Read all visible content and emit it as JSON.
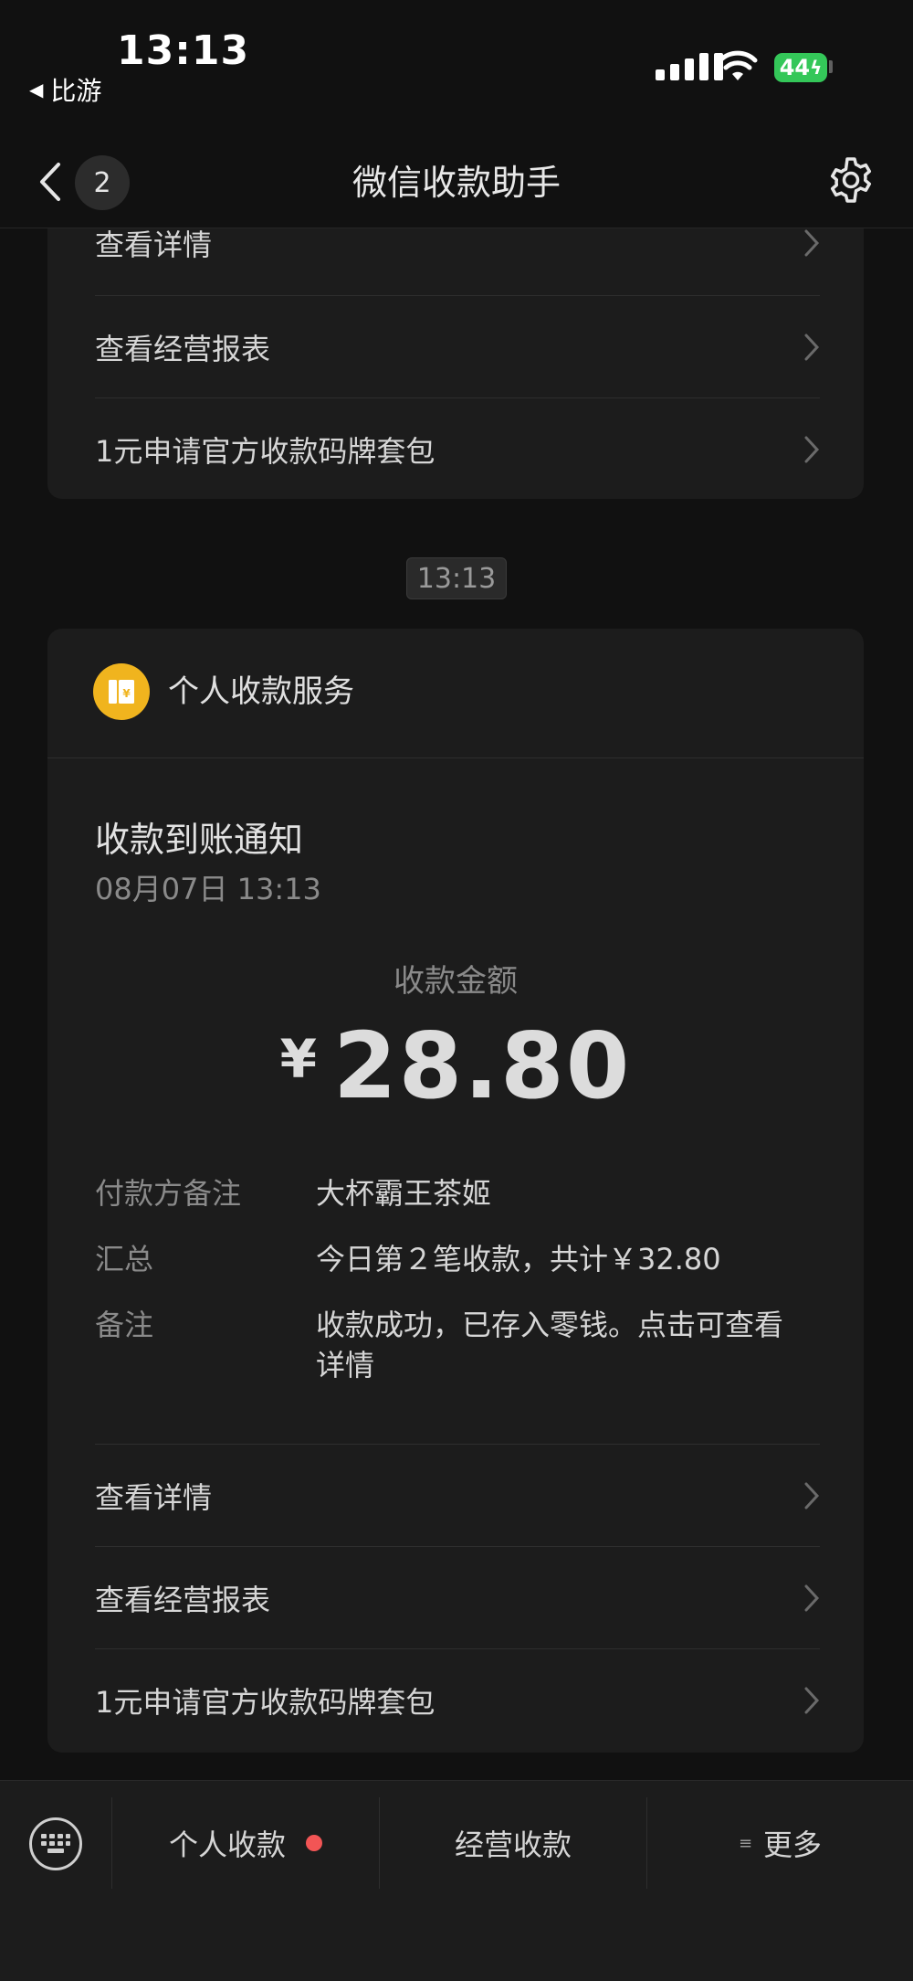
{
  "status_bar": {
    "time": "13:13",
    "back_app": "比游",
    "battery": "44"
  },
  "nav": {
    "title": "微信收款助手",
    "unread_count": "2",
    "icons": {
      "back": "chevron-left-icon",
      "settings": "gear-icon"
    }
  },
  "top_card": {
    "menu": [
      {
        "label": "查看详情"
      },
      {
        "label": "查看经营报表"
      },
      {
        "label": "1元申请官方收款码牌套包"
      }
    ]
  },
  "timestamp": "13:13",
  "message_card": {
    "service_name": "个人收款服务",
    "notice_title": "收款到账通知",
    "notice_date": "08月07日 13:13",
    "amount_label": "收款金额",
    "currency": "¥",
    "amount": "28.80",
    "details": [
      {
        "key": "付款方备注",
        "value": "大杯霸王茶姬"
      },
      {
        "key": "汇总",
        "value": "今日第２笔收款，共计￥32.80"
      },
      {
        "key": "备注",
        "value": "收款成功，已存入零钱。点击可查看详情"
      }
    ],
    "menu": [
      {
        "label": "查看详情"
      },
      {
        "label": "查看经营报表"
      },
      {
        "label": "1元申请官方收款码牌套包"
      }
    ]
  },
  "bottom_bar": {
    "tabs": [
      {
        "label": "个人收款",
        "has_dot": true
      },
      {
        "label": "经营收款"
      },
      {
        "label": "更多"
      }
    ],
    "colors": {
      "dot": "#f25555",
      "service_icon": "#f0b41e"
    }
  }
}
